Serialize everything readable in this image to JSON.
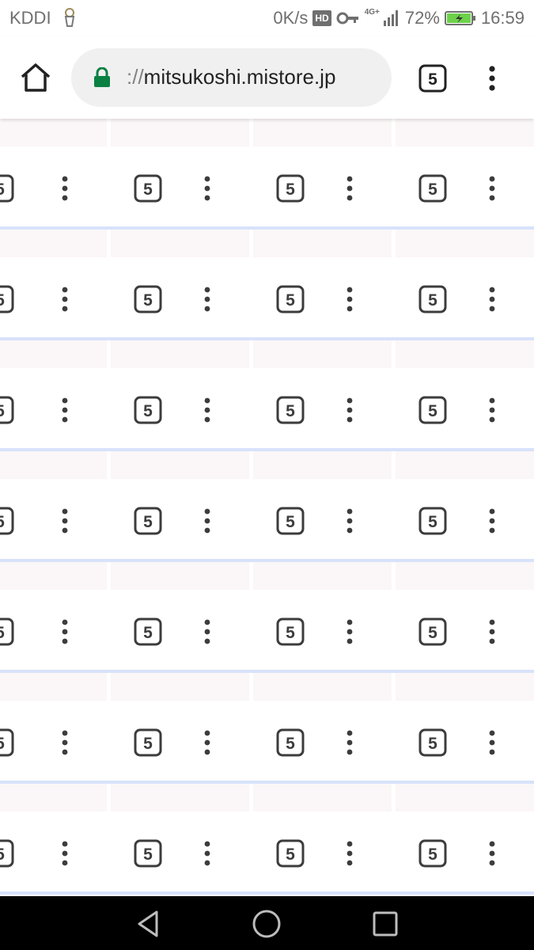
{
  "status_bar": {
    "carrier": "KDDI",
    "speed": "0K/s",
    "hd": "HD",
    "network": "4G+",
    "battery": "72%",
    "time": "16:59"
  },
  "toolbar": {
    "url_scheme": "://",
    "url_host": "mitsukoshi.mistore.jp",
    "tab_count": "5"
  },
  "grid": {
    "row_count": 7,
    "columns": 4,
    "tab_count_label": "5"
  },
  "colors": {
    "accent_line": "#d8e2fb",
    "cell_background": "#fbf6f7",
    "lock_green": "#0b8043",
    "icon_dark": "#3c3c3c",
    "battery_green": "#6dd14a"
  }
}
